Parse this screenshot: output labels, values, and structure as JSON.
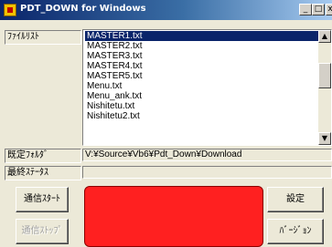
{
  "window": {
    "title": "PDT_DOWN for Windows",
    "controls": {
      "minimize": "_",
      "maximize": "□",
      "close": "x"
    }
  },
  "file_list": {
    "label": "ﾌｧｲﾙﾘｽﾄ",
    "items": [
      "MASTER1.txt",
      "MASTER2.txt",
      "MASTER3.txt",
      "MASTER4.txt",
      "MASTER5.txt",
      "Menu.txt",
      "Menu_ank.txt",
      "Nishitetu.txt",
      "Nishitetu2.txt"
    ],
    "selected_index": 0,
    "scroll_up": "▲",
    "scroll_down": "▼"
  },
  "default_folder": {
    "label": "既定ﾌｫﾙﾀﾞ",
    "value": "V:¥Source¥Vb6¥Pdt_Down¥Download"
  },
  "final_status": {
    "label": "最終ｽﾃｰﾀｽ",
    "value": ""
  },
  "buttons": {
    "start_comm": "通信ｽﾀｰﾄ",
    "stop_comm": "通信ｽﾄｯﾌﾟ",
    "settings": "設定",
    "version": "ﾊﾞｰｼﾞｮﾝ"
  },
  "status_indicator_color": "#ff2020"
}
